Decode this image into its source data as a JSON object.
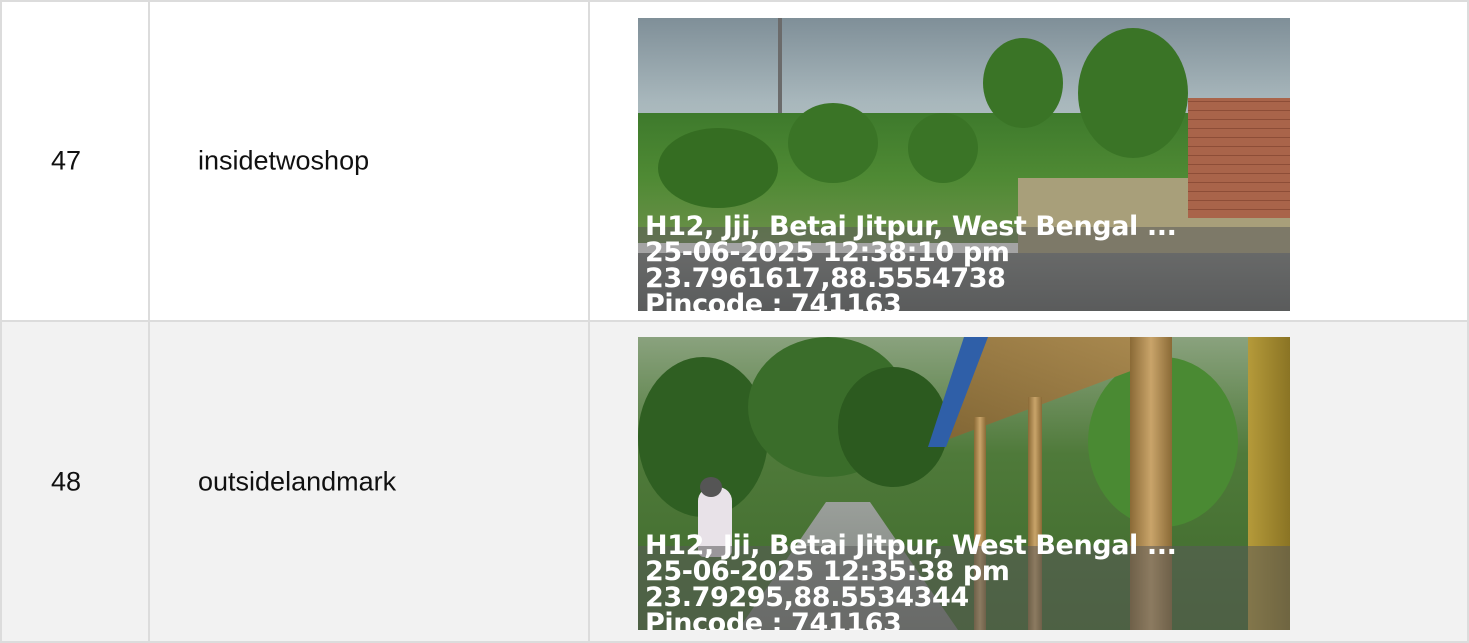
{
  "rows": [
    {
      "number": "47",
      "label": "insidetwoshop",
      "photo": {
        "address": "H12, Jji, Betai Jitpur, West Bengal ...",
        "datetime": "25-06-2025 12:38:10 pm",
        "coordinates": "23.7961617,88.5554738",
        "pincode": "Pincode : 741163"
      }
    },
    {
      "number": "48",
      "label": "outsidelandmark",
      "photo": {
        "address": "H12, Jji, Betai Jitpur, West Bengal ...",
        "datetime": "25-06-2025 12:35:38 pm",
        "coordinates": "23.79295,88.5534344",
        "pincode": "Pincode : 741163"
      }
    }
  ],
  "colors": {
    "border": "#dcdcdc",
    "row_alt_background": "#f2f2f2",
    "text": "#111111",
    "stamp_text": "#ffffff"
  }
}
